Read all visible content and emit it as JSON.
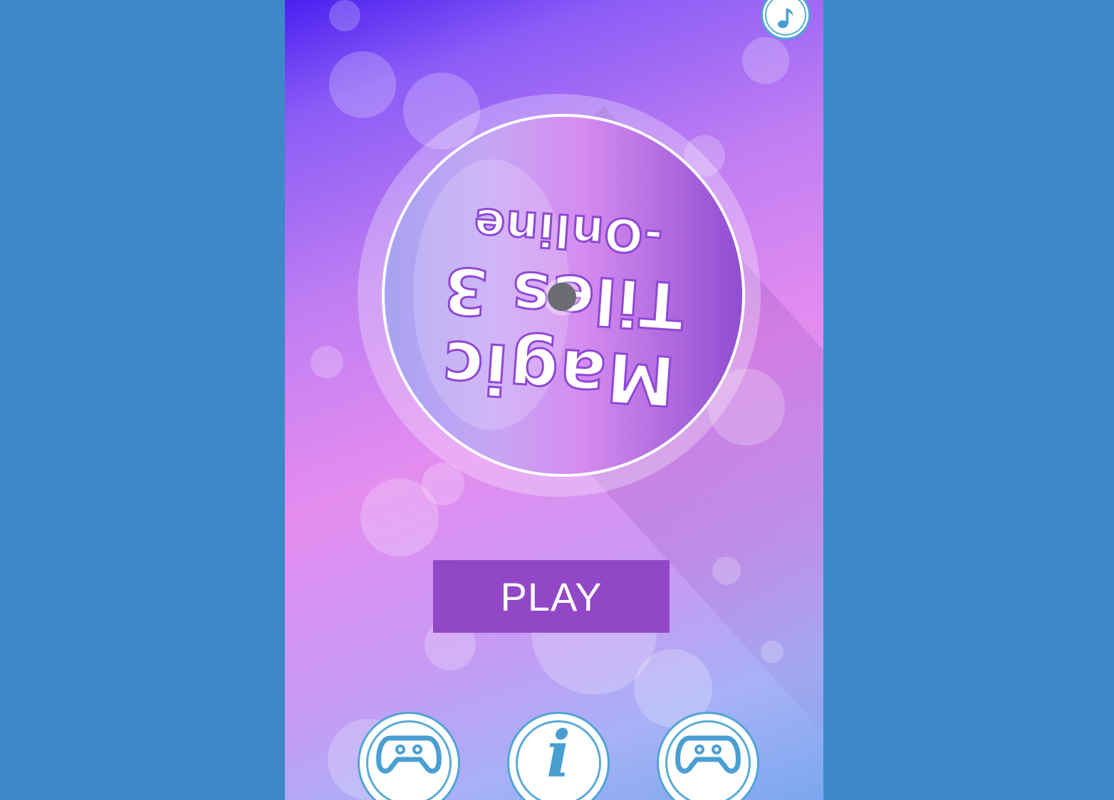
{
  "page": {
    "background_color": "#3d89c8"
  },
  "game": {
    "title_lines": [
      "Magic",
      "Tiles 3",
      "-Online"
    ],
    "title_rotated_upside_down": true,
    "play_label": "PLAY",
    "colors": {
      "play_button": "#9248c6",
      "icon_blue": "#4a9fd2",
      "title_stroke": "#8f47d6"
    },
    "top_button": {
      "icon": "music-note-icon"
    },
    "bottom_buttons": [
      {
        "icon": "gamepad-icon"
      },
      {
        "icon": "info-icon",
        "glyph": "i"
      },
      {
        "icon": "gamepad-icon"
      }
    ]
  }
}
